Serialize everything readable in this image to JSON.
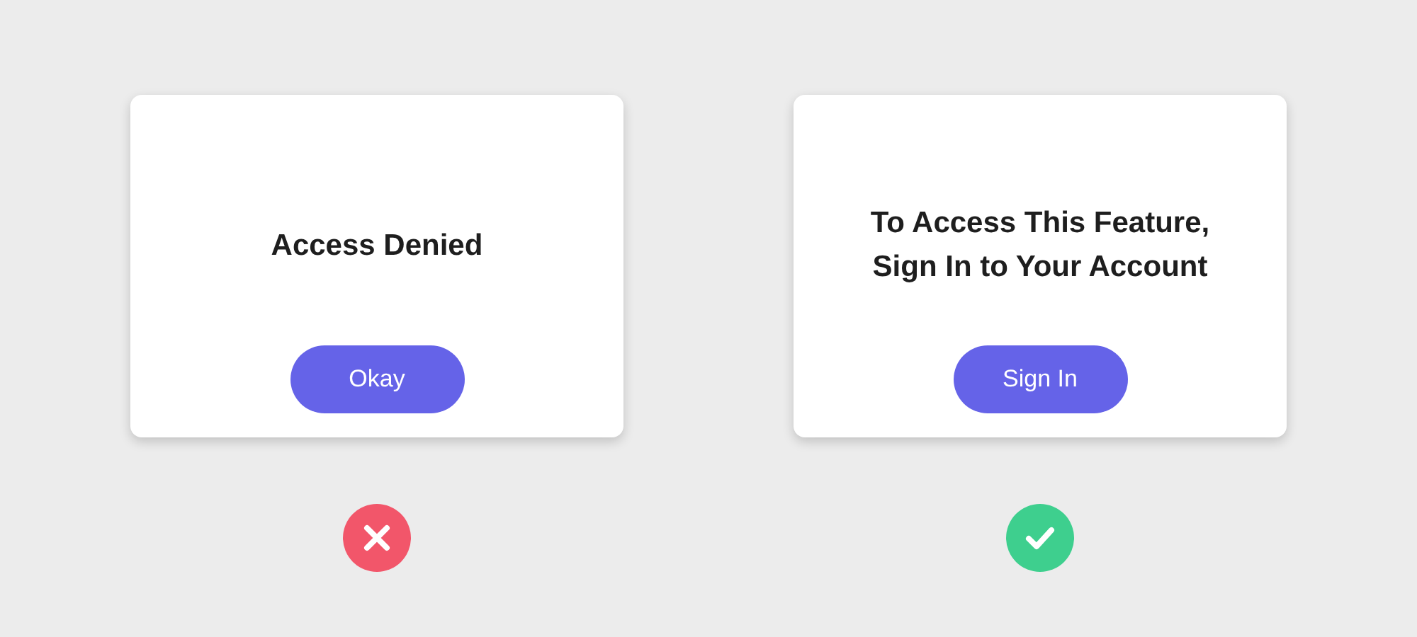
{
  "panels": [
    {
      "title": "Access Denied",
      "button": "Okay",
      "verdict": {
        "kind": "cross",
        "color": "#f2566a"
      }
    },
    {
      "title": "To Access This Feature, Sign In to Your Account",
      "button": "Sign In",
      "verdict": {
        "kind": "check",
        "color": "#3ecf8e"
      }
    }
  ]
}
